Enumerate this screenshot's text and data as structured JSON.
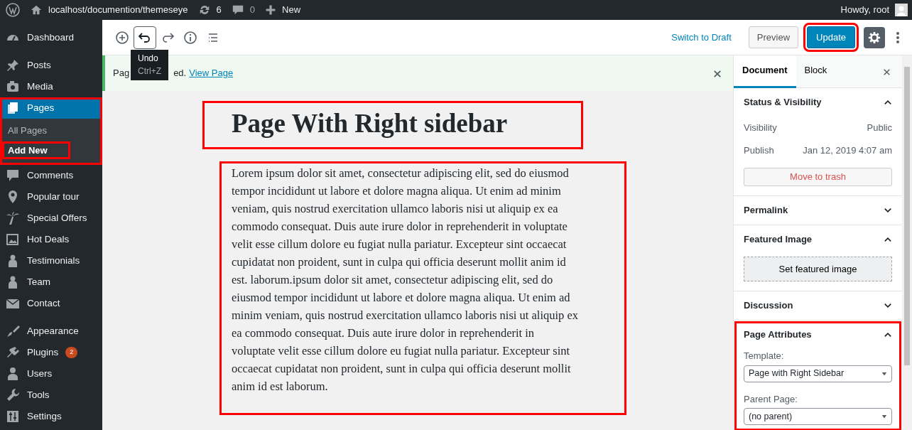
{
  "admin_bar": {
    "site": "localhost/documention/themeseye",
    "updates": "6",
    "comments": "0",
    "new": "New",
    "greeting": "Howdy, root"
  },
  "menu": [
    {
      "label": "Dashboard",
      "selected": false,
      "group_end": true
    },
    {
      "label": "Posts",
      "selected": false
    },
    {
      "label": "Media",
      "selected": false
    },
    {
      "label": "Pages",
      "selected": true,
      "highlighted": true,
      "children": [
        {
          "label": "All Pages",
          "selected": false,
          "highlighted": false
        },
        {
          "label": "Add New",
          "selected": true,
          "highlighted": true
        }
      ]
    },
    {
      "label": "Comments",
      "selected": false
    },
    {
      "label": "Popular tour",
      "selected": false
    },
    {
      "label": "Special Offers",
      "selected": false
    },
    {
      "label": "Hot Deals",
      "selected": false
    },
    {
      "label": "Testimonials",
      "selected": false
    },
    {
      "label": "Team",
      "selected": false
    },
    {
      "label": "Contact",
      "selected": false,
      "group_end": true
    },
    {
      "label": "Appearance",
      "selected": false
    },
    {
      "label": "Plugins",
      "selected": false,
      "badge": "2"
    },
    {
      "label": "Users",
      "selected": false
    },
    {
      "label": "Tools",
      "selected": false
    },
    {
      "label": "Settings",
      "selected": false
    }
  ],
  "toolbar": {
    "tooltip": {
      "title": "Undo",
      "shortcut": "Ctrl+Z"
    },
    "switch_draft": "Switch to Draft",
    "preview": "Preview",
    "update": {
      "label": "Update",
      "highlighted": true
    }
  },
  "notice": {
    "text_start": "Pag",
    "text_end": "ed.",
    "link": "View Page"
  },
  "post": {
    "title": {
      "text": "Page With Right sidebar",
      "highlighted": true
    },
    "content": {
      "text": "Lorem ipsum dolor sit amet, consectetur adipiscing elit, sed do eiusmod tempor incididunt ut labore et dolore magna aliqua. Ut enim ad minim veniam, quis nostrud exercitation ullamco laboris nisi ut aliquip ex ea commodo consequat. Duis aute irure dolor in reprehenderit in voluptate velit esse cillum dolore eu fugiat nulla pariatur. Excepteur sint occaecat cupidatat non proident, sunt in culpa qui officia deserunt mollit anim id est. laborum.ipsum dolor sit amet, consectetur adipiscing elit, sed do eiusmod tempor incididunt ut labore et dolore magna aliqua. Ut enim ad minim veniam, quis nostrud exercitation ullamco laboris nisi ut aliquip ex ea commodo consequat. Duis aute irure dolor in reprehenderit in voluptate velit esse cillum dolore eu fugiat nulla pariatur. Excepteur sint occaecat cupidatat non proident, sunt in culpa qui officia deserunt mollit anim id est laborum.",
      "highlighted": true
    }
  },
  "settings": {
    "tabs": [
      {
        "label": "Document",
        "selected": true
      },
      {
        "label": "Block",
        "selected": false
      }
    ],
    "panels": [
      {
        "kind": "status",
        "title": "Status & Visibility",
        "expanded": true,
        "highlighted": false,
        "rows": [
          {
            "label": "Visibility",
            "value": "Public"
          },
          {
            "label": "Publish",
            "value": "Jan 12, 2019 4:07 am"
          }
        ],
        "button": "Move to trash"
      },
      {
        "kind": "plain",
        "title": "Permalink",
        "expanded": false,
        "highlighted": false
      },
      {
        "kind": "image",
        "title": "Featured Image",
        "expanded": true,
        "highlighted": false,
        "button": "Set featured image"
      },
      {
        "kind": "plain",
        "title": "Discussion",
        "expanded": false,
        "highlighted": false
      },
      {
        "kind": "attributes",
        "title": "Page Attributes",
        "expanded": true,
        "highlighted": true,
        "fields": [
          {
            "label": "Template:",
            "value": "Page with Right Sidebar"
          },
          {
            "label": "Parent Page:",
            "value": "(no parent)"
          }
        ]
      }
    ]
  }
}
